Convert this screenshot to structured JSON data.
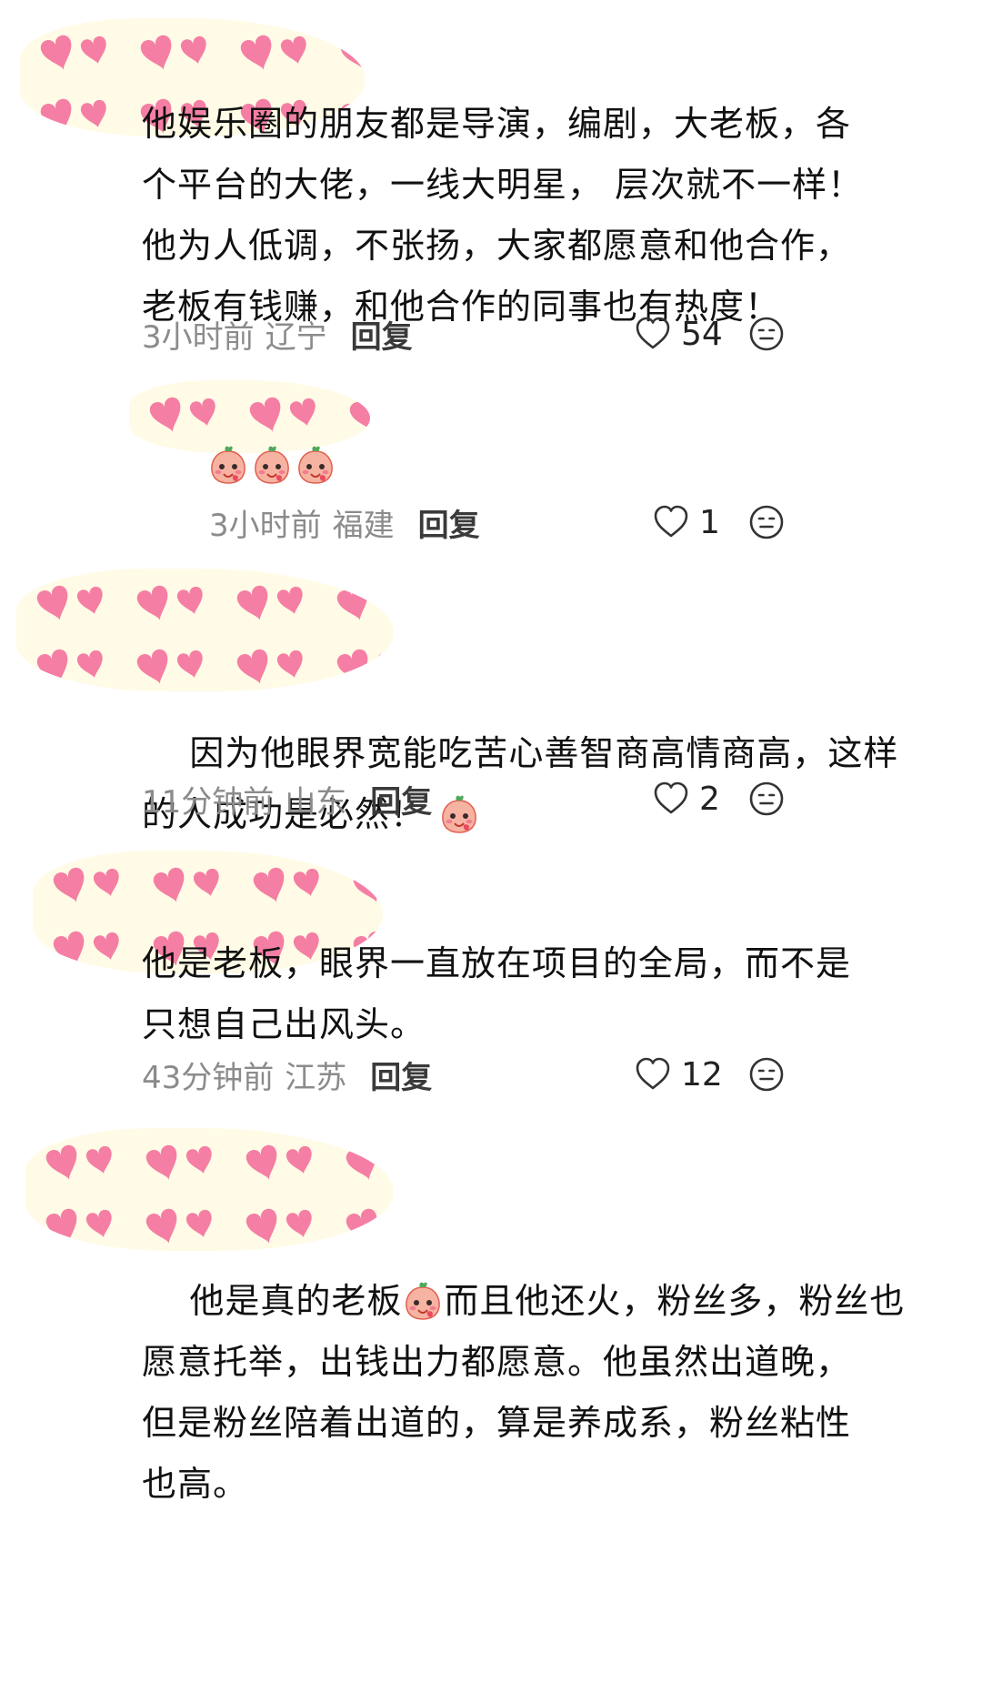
{
  "comments": [
    {
      "text": "他娱乐圈的朋友都是导演，编剧，大老板，各\n个平台的大佬，一线大明星， 层次就不一样！\n他为人低调，不张扬，大家都愿意和他合作，\n老板有钱赚，和他合作的同事也有热度！",
      "time": "3小时前",
      "location": "辽宁",
      "reply_label": "回复",
      "likes": "54"
    },
    {
      "text": "",
      "time": "3小时前",
      "location": "福建",
      "reply_label": "回复",
      "likes": "1"
    },
    {
      "text": "因为他眼界宽能吃苦心善智商高情商高，这样\n的人成功是必然！",
      "time": "11分钟前",
      "location": "山东",
      "reply_label": "回复",
      "likes": "2"
    },
    {
      "text": "他是老板，眼界一直放在项目的全局，而不是\n只想自己出风头。",
      "time": "43分钟前",
      "location": "江苏",
      "reply_label": "回复",
      "likes": "12"
    },
    {
      "text_before_sticker": "他是真的老板",
      "text_after_sticker": "而且他还火，粉丝多，粉丝也\n愿意托举，出钱出力都愿意。他虽然出道晚，\n但是粉丝陪着出道的，算是养成系，粉丝粘性\n也高。"
    }
  ],
  "icons": {
    "like": "heart-outline-icon",
    "dislike": "neutral-face-icon",
    "sticker": "peach-sticker",
    "mask": "pink-heart-pattern"
  },
  "colors": {
    "mask_background": "#fffbe6",
    "mask_heart": "#f57ea4",
    "meta_text": "#8b8b8b",
    "body_text": "#111111"
  }
}
